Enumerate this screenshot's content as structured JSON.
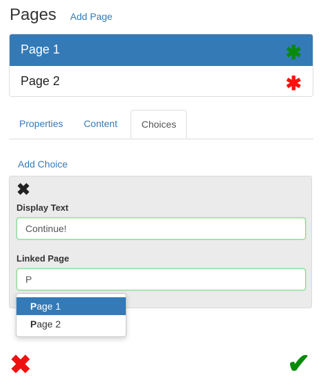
{
  "header": {
    "title": "Pages",
    "add_page_label": "Add Page"
  },
  "pages": [
    {
      "label": "Page 1",
      "status_icon": "green-asterisk-icon",
      "status_color": "#0a8a0a",
      "selected": true
    },
    {
      "label": "Page 2",
      "status_icon": "red-asterisk-icon",
      "status_color": "#ff1111",
      "selected": false
    }
  ],
  "tabs": [
    {
      "label": "Properties",
      "active": false
    },
    {
      "label": "Content",
      "active": false
    },
    {
      "label": "Choices",
      "active": true
    }
  ],
  "choices": {
    "add_choice_label": "Add Choice",
    "remove_icon": "close-icon",
    "display_text_label": "Display Text",
    "display_text_value": "Continue!",
    "linked_page_label": "Linked Page",
    "linked_page_value": "P",
    "suggestions": [
      {
        "match": "P",
        "rest": "age 1",
        "active": true
      },
      {
        "match": "P",
        "rest": "age 2",
        "active": false
      }
    ]
  },
  "footer": {
    "cancel_icon": "red-x-icon",
    "confirm_icon": "green-check-icon"
  },
  "colors": {
    "accent": "#337ab7",
    "success": "#0a8a0a",
    "danger": "#ee1111"
  }
}
